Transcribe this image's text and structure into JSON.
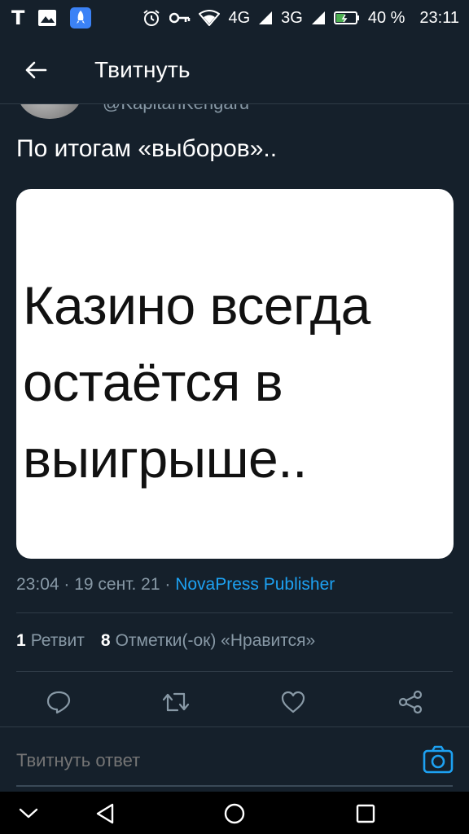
{
  "status_bar": {
    "app_icon_letter": "T",
    "network_4g": "4G",
    "network_3g": "3G",
    "battery": "40 %",
    "time": "23:11"
  },
  "header": {
    "title": "Твитнуть"
  },
  "tweet": {
    "handle": "@KapitanKengaru",
    "text": "По итогам «выборов»..",
    "media_lines": [
      "Казино всегда",
      "остаётся в",
      "выигрыше.."
    ],
    "time": "23:04",
    "date": "19 сент. 21",
    "source": "NovaPress Publisher",
    "retweet_count": "1",
    "retweet_label": "Ретвит",
    "like_count": "8",
    "like_label": "Отметки(-ок) «Нравится»"
  },
  "reply": {
    "placeholder": "Твитнуть ответ"
  },
  "colors": {
    "background": "#15202b",
    "accent": "#1da1f2",
    "muted": "#8899a6"
  },
  "icons": [
    "back-arrow-icon",
    "reply-icon",
    "retweet-icon",
    "like-icon",
    "share-icon",
    "camera-icon",
    "nav-down-icon",
    "nav-back-icon",
    "nav-home-icon",
    "nav-recents-icon"
  ]
}
